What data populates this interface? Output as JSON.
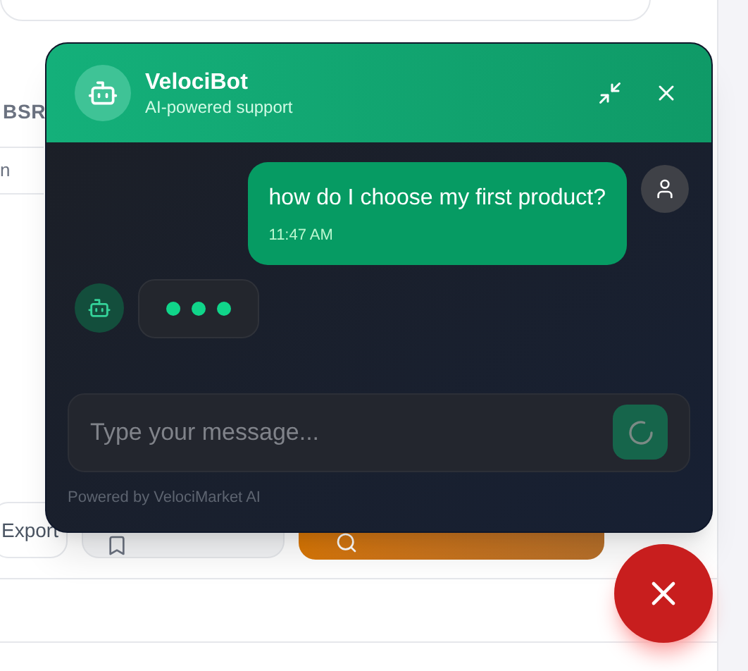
{
  "background": {
    "filter_label": "BSR",
    "field_value": "n",
    "buttons": [
      {
        "kind": "export",
        "label": "Export"
      },
      {
        "kind": "save"
      },
      {
        "kind": "search"
      }
    ]
  },
  "chat": {
    "title": "VelociBot",
    "subtitle": "AI-powered support",
    "messages": [
      {
        "kind": "user",
        "text": "how do I choose my first product?",
        "time": "11:47 AM"
      },
      {
        "kind": "typing"
      }
    ],
    "input": {
      "placeholder": "Type your message...",
      "sending": true
    },
    "footer": "Powered by VelociMarket AI"
  },
  "fab": {
    "open": true
  }
}
